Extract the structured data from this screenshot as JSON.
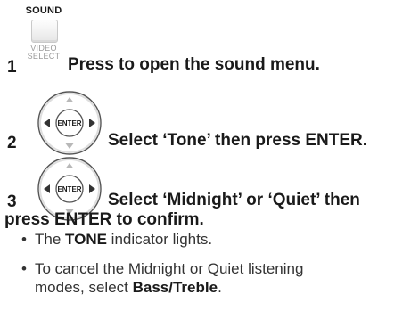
{
  "steps": [
    {
      "number": "1",
      "text": "Press to open the sound menu.",
      "icon": "sound-button-icon"
    },
    {
      "number": "2",
      "text": "Select ‘Tone’ then press ENTER.",
      "icon": "enter-dpad-icon"
    },
    {
      "number": "3",
      "text_line1": "Select ‘Midnight’ or ‘Quiet’ then",
      "text_line2": "press ENTER to confirm.",
      "icon": "enter-dpad-icon"
    }
  ],
  "sound_button": {
    "label": "SOUND",
    "sub_line1": "VIDEO",
    "sub_line2": "SELECT"
  },
  "dpad": {
    "center_label": "ENTER"
  },
  "notes": [
    {
      "prefix": "The ",
      "bold": "TONE",
      "suffix": " indicator lights."
    },
    {
      "prefix": "To cancel the Midnight or Quiet listening",
      "line2_prefix": "modes, select ",
      "bold": "Bass/Treble",
      "suffix": "."
    }
  ],
  "colors": {
    "text": "#1a1a1a",
    "notes_text": "#333333",
    "dpad_ring": "#555555",
    "muted": "#9a9a9a"
  }
}
